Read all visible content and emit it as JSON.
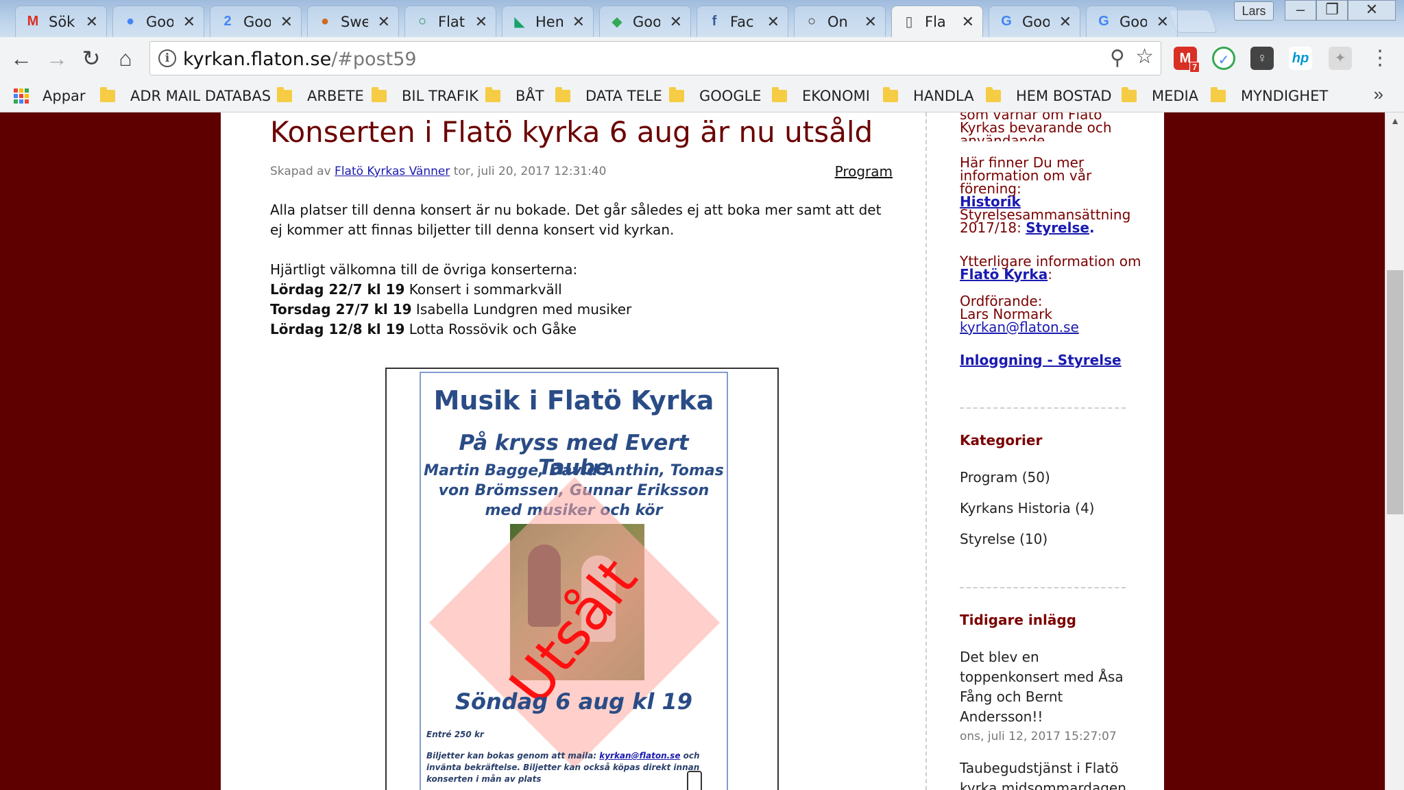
{
  "browser": {
    "tabs": [
      {
        "icon": "gmail-icon",
        "glyph": "M",
        "color": "#d93025",
        "label": "Sök"
      },
      {
        "icon": "google-contacts-icon",
        "glyph": "●",
        "color": "#4285f4",
        "label": "Goo"
      },
      {
        "icon": "google-calendar-icon",
        "glyph": "2",
        "color": "#4285f4",
        "label": "Goo"
      },
      {
        "icon": "swedbank-icon",
        "glyph": "●",
        "color": "#d2691e",
        "label": "Swe"
      },
      {
        "icon": "flatö-site-icon",
        "glyph": "○",
        "color": "#2e8b57",
        "label": "Flat"
      },
      {
        "icon": "hemnet-icon",
        "glyph": "◣",
        "color": "#1aa36a",
        "label": "Hem"
      },
      {
        "icon": "google-maps-icon",
        "glyph": "◆",
        "color": "#34a853",
        "label": "Goo"
      },
      {
        "icon": "facebook-icon",
        "glyph": "f",
        "color": "#3b5998",
        "label": "Fac"
      },
      {
        "icon": "onedrive-icon",
        "glyph": "○",
        "color": "#333333",
        "label": "On"
      },
      {
        "icon": "document-icon",
        "glyph": "▯",
        "color": "#555555",
        "label": "Fla"
      },
      {
        "icon": "google-icon",
        "glyph": "G",
        "color": "#4285f4",
        "label": "Goo"
      },
      {
        "icon": "google-icon",
        "glyph": "G",
        "color": "#4285f4",
        "label": "Goo"
      }
    ],
    "profile": "Lars",
    "url_host": "kyrkan.flaton.se",
    "url_path": "/#post59",
    "gmail_badge": "7",
    "bookmarks": {
      "apps_label": "Appar",
      "folders": [
        "ADR MAIL DATABAS",
        "ARBETE",
        "BIL TRAFIK",
        "BÅT",
        "DATA TELE",
        "GOOGLE",
        "EKONOMI",
        "HANDLA",
        "HEM BOSTAD",
        "MEDIA",
        "MYNDIGHET"
      ],
      "more": "»"
    }
  },
  "post": {
    "title": "Konserten i Flatö kyrka 6 aug är nu utsåld",
    "meta_prefix": "Skapad av",
    "author": "Flatö Kyrkas Vänner",
    "date": "tor, juli 20, 2017 12:31:40",
    "category": "Program",
    "paragraph1": "Alla platser till denna konsert är nu bokade. Det går således ej att boka mer samt att det ej kommer att finnas biljetter till denna konsert vid kyrkan.",
    "intro": "Hjärtligt välkomna till de övriga konserterna:",
    "concerts": [
      {
        "when": "Lördag 22/7 kl 19",
        "what": " Konsert i sommarkväll"
      },
      {
        "when": "Torsdag 27/7 kl 19",
        "what": " Isabella Lundgren med musiker"
      },
      {
        "when": "Lördag 12/8 kl 19",
        "what": " Lotta Rossövik och Gåke"
      }
    ]
  },
  "poster": {
    "title": "Musik i Flatö Kyrka",
    "subtitle": "På kryss med Evert Taube",
    "performers": "Martin Bagge, David Anthin, Tomas von Brömssen, Gunnar Eriksson  med musiker och kör",
    "stamp": "Utsålt",
    "date": "Söndag 6 aug kl 19",
    "entry": "Entré 250 kr",
    "tickets_prefix": "Biljetter  kan bokas genom att maila: ",
    "tickets_email": "kyrkan@flaton.se",
    "tickets_suffix": " och invänta bekräftelse. Biljetter kan också köpas direkt innan konserten i mån av plats"
  },
  "sidebar": {
    "top_text": "som värnar om Flatö Kyrkas bevarande och användande.",
    "info_text": "Här finner Du mer information om vår förening:",
    "historik": "Historik",
    "styrelse_prefix": "Styrelsesammansättning 2017/18: ",
    "styrelse": "Styrelse",
    "more_prefix": "Ytterligare information om ",
    "flato_kyrka": "Flatö Kyrka",
    "chair_label": "Ordförande:",
    "chair_name": "Lars Normark",
    "email": "kyrkan@flaton.se",
    "login": "Inloggning - Styrelse",
    "categories_title": "Kategorier",
    "categories": [
      "Program (50)",
      "Kyrkans Historia (4)",
      "Styrelse (10)"
    ],
    "earlier_title": "Tidigare inlägg",
    "earlier_post_title": "Det blev en toppenkonsert med Åsa Fång och Bernt Andersson!!",
    "earlier_post_date": "ons, juli 12, 2017 15:27:07",
    "next_post_title": "Taubegudstjänst i Flatö kyrka midsommardagen"
  },
  "colors": {
    "page_background": "#5e0000",
    "title_color": "#6b0000",
    "link_color": "#1a1ab0"
  }
}
